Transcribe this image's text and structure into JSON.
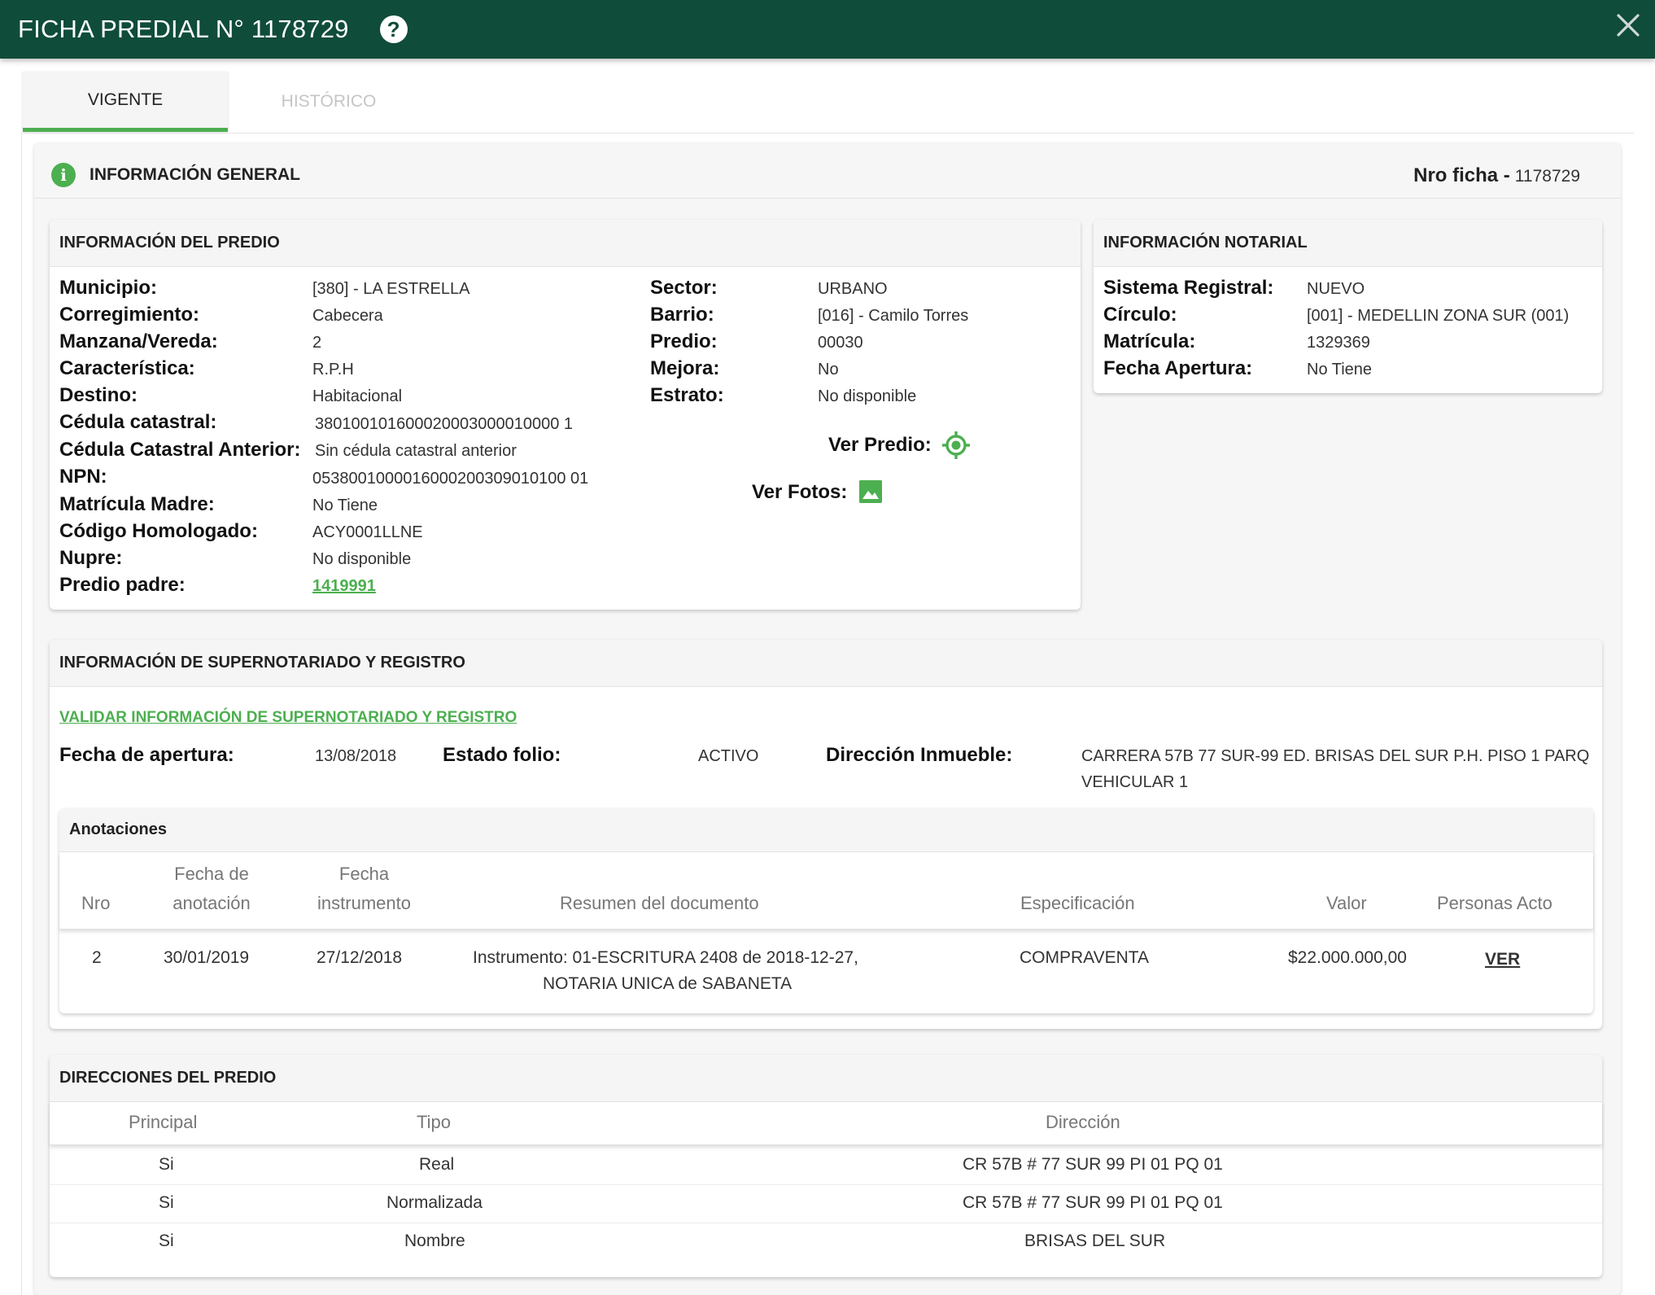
{
  "header": {
    "title": "FICHA PREDIAL N° 1178729",
    "help_icon": "?"
  },
  "tabs": [
    {
      "label": "VIGENTE"
    },
    {
      "label": "HISTÓRICO"
    }
  ],
  "general": {
    "title": "INFORMACIÓN GENERAL",
    "nro_label": "Nro ficha -",
    "nro_value": "1178729"
  },
  "predio": {
    "title": "INFORMACIÓN DEL PREDIO",
    "left": [
      {
        "label": "Municipio:",
        "value": "[380] - LA ESTRELLA"
      },
      {
        "label": "Corregimiento:",
        "value": "Cabecera"
      },
      {
        "label": "Manzana/Vereda:",
        "value": "2"
      },
      {
        "label": "Característica:",
        "value": "R.P.H"
      },
      {
        "label": "Destino:",
        "value": "Habitacional"
      },
      {
        "label": "Cédula catastral:",
        "value": "380100101600020003000010000 1"
      },
      {
        "label": "Cédula Catastral Anterior:",
        "value": "Sin cédula catastral anterior"
      },
      {
        "label": "NPN:",
        "value": "0538001000016000200309010100 01"
      },
      {
        "label": "Matrícula Madre:",
        "value": "No Tiene"
      },
      {
        "label": "Código Homologado:",
        "value": "ACY0001LLNE"
      },
      {
        "label": "Nupre:",
        "value": "No disponible"
      },
      {
        "label": "Predio padre:",
        "value": "1419991"
      }
    ],
    "right": [
      {
        "label": "Sector:",
        "value": "URBANO"
      },
      {
        "label": "Barrio:",
        "value": "[016] - Camilo Torres"
      },
      {
        "label": "Predio:",
        "value": "00030"
      },
      {
        "label": "Mejora:",
        "value": "No"
      },
      {
        "label": "Estrato:",
        "value": "No disponible"
      }
    ],
    "ver_predio": "Ver Predio:",
    "ver_fotos": "Ver Fotos:"
  },
  "notarial": {
    "title": "INFORMACIÓN NOTARIAL",
    "rows": [
      {
        "label": "Sistema Registral:",
        "value": "NUEVO"
      },
      {
        "label": "Círculo:",
        "value": "[001] - MEDELLIN ZONA SUR (001)"
      },
      {
        "label": "Matrícula:",
        "value": "1329369"
      },
      {
        "label": "Fecha Apertura:",
        "value": "No Tiene"
      }
    ]
  },
  "supernot": {
    "title": "INFORMACIÓN DE SUPERNOTARIADO Y REGISTRO",
    "validar_link": "VALIDAR INFORMACIÓN DE SUPERNOTARIADO Y REGISTRO",
    "fecha_label": "Fecha de apertura:",
    "fecha_value": "13/08/2018",
    "estado_label": "Estado folio:",
    "estado_value": "ACTIVO",
    "direccion_label": "Dirección Inmueble:",
    "direccion_line1": "CARRERA 57B 77 SUR-99 ED. BRISAS DEL SUR P.H. PISO 1 PARQ",
    "direccion_line2": "VEHICULAR 1",
    "anotaciones": {
      "title": "Anotaciones",
      "headers": {
        "nro": "Nro",
        "fecha_anot_1": "Fecha de",
        "fecha_anot_2": "anotación",
        "fecha_inst_1": "Fecha",
        "fecha_inst_2": "instrumento",
        "resumen": "Resumen del documento",
        "especificacion": "Especificación",
        "valor": "Valor",
        "personas": "Personas Acto"
      },
      "row": {
        "nro": "2",
        "fecha_anotacion": "30/01/2019",
        "fecha_instrumento": "27/12/2018",
        "resumen_1": "Instrumento: 01-ESCRITURA 2408 de 2018-12-27,",
        "resumen_2": "NOTARIA UNICA de SABANETA",
        "especificacion": "COMPRAVENTA",
        "valor": "$22.000.000,00",
        "personas": "VER"
      }
    }
  },
  "direcciones": {
    "title": "DIRECCIONES DEL PREDIO",
    "headers": {
      "principal": "Principal",
      "tipo": "Tipo",
      "direccion": "Dirección"
    },
    "rows": [
      {
        "principal": "Si",
        "tipo": "Real",
        "direccion": "CR 57B # 77 SUR 99 PI 01 PQ 01"
      },
      {
        "principal": "Si",
        "tipo": "Normalizada",
        "direccion": "CR 57B # 77 SUR 99 PI 01 PQ 01"
      },
      {
        "principal": "Si",
        "tipo": "Nombre",
        "direccion": "BRISAS DEL SUR"
      }
    ]
  },
  "colors": {
    "header_bg": "#0f4c3a",
    "accent": "#4caf50"
  }
}
